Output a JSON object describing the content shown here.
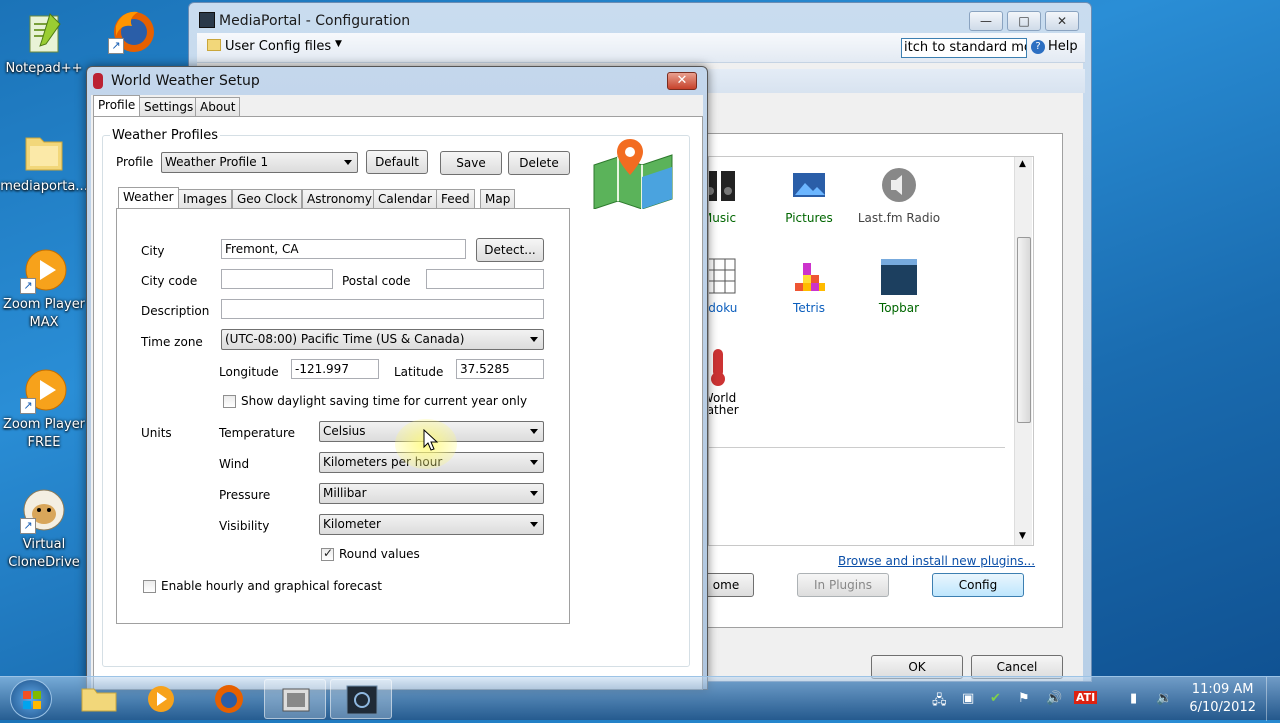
{
  "desktop": {
    "icons": [
      {
        "label": "Notepad++"
      },
      {
        "label": "mediaporta..."
      },
      {
        "label": "Zoom Player MAX"
      },
      {
        "label": "Zoom Player FREE"
      },
      {
        "label": "Virtual CloneDrive"
      }
    ]
  },
  "main_window": {
    "title": "MediaPortal - Configuration",
    "menu_label": "User Config files",
    "mode_field": "itch to standard mo",
    "help_label": "Help",
    "plugins": [
      {
        "label": "Music"
      },
      {
        "label": "Pictures"
      },
      {
        "label": "Last.fm Radio"
      },
      {
        "label": "udoku"
      },
      {
        "label": "Tetris"
      },
      {
        "label": "Topbar"
      },
      {
        "label": "World"
      },
      {
        "label": "eather"
      }
    ],
    "browse_link": "Browse and install new plugins...",
    "btn_home": "ome",
    "btn_in_plugins": "In Plugins",
    "btn_config": "Config",
    "btn_ok": "OK",
    "btn_cancel": "Cancel"
  },
  "dialog": {
    "title": "World Weather Setup",
    "tabs": [
      "Profile",
      "Settings",
      "About"
    ],
    "group_title": "Weather Profiles",
    "profile_label": "Profile",
    "profile_value": "Weather Profile 1",
    "btn_default": "Default",
    "btn_save": "Save",
    "btn_delete": "Delete",
    "inner_tabs": [
      "Weather",
      "Images",
      "Geo Clock",
      "Astronomy",
      "Calendar",
      "Feed",
      "Map"
    ],
    "city_label": "City",
    "city_value": "Fremont, CA",
    "btn_detect": "Detect...",
    "city_code_label": "City code",
    "city_code_value": "",
    "postal_label": "Postal code",
    "postal_value": "",
    "description_label": "Description",
    "description_value": "",
    "timezone_label": "Time zone",
    "timezone_value": "(UTC-08:00) Pacific Time (US & Canada)",
    "longitude_label": "Longitude",
    "longitude_value": "-121.997",
    "latitude_label": "Latitude",
    "latitude_value": "37.5285",
    "dst_label": "Show daylight saving time for current year only",
    "units_label": "Units",
    "temperature_label": "Temperature",
    "temperature_value": "Celsius",
    "wind_label": "Wind",
    "wind_value": "Kilometers per hour",
    "pressure_label": "Pressure",
    "pressure_value": "Millibar",
    "visibility_label": "Visibility",
    "visibility_value": "Kilometer",
    "round_label": "Round values",
    "hourly_label": "Enable hourly and graphical forecast"
  },
  "taskbar": {
    "time": "11:09 AM",
    "date": "6/10/2012"
  }
}
